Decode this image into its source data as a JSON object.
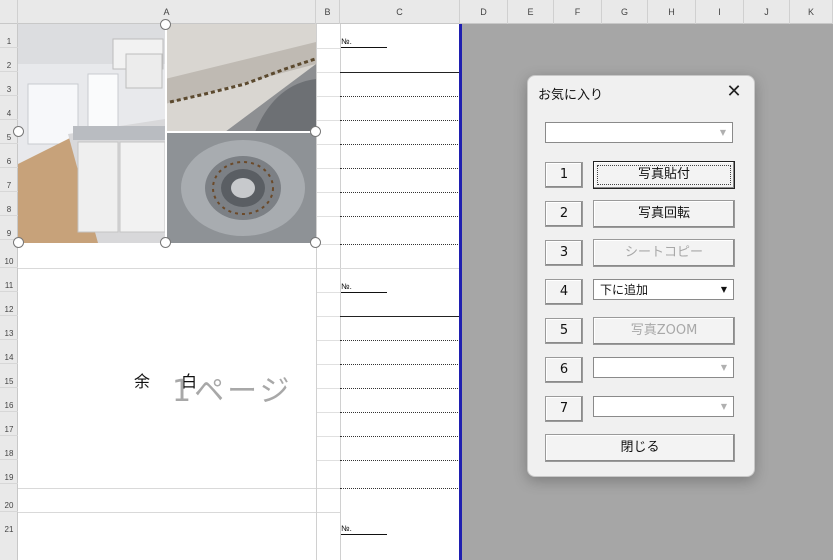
{
  "columns": [
    "A",
    "B",
    "C",
    "D",
    "E",
    "F",
    "G",
    "H",
    "I",
    "J",
    "K"
  ],
  "rows": [
    "1",
    "2",
    "3",
    "4",
    "5",
    "6",
    "7",
    "8",
    "9",
    "10",
    "11",
    "12",
    "13",
    "14",
    "15",
    "16",
    "17",
    "18",
    "19",
    "20",
    "21"
  ],
  "sheet": {
    "no_label": "№.",
    "margin_left": "余",
    "margin_right": "白",
    "page_label": "1ページ"
  },
  "dialog": {
    "title": "お気に入り",
    "close_symbol": "✕",
    "top_combo_value": "",
    "numbers": [
      "1",
      "2",
      "3",
      "4",
      "5",
      "6",
      "7"
    ],
    "actions": {
      "paste_photo": "写真貼付",
      "rotate_photo": "写真回転",
      "copy_sheet": "シートコピー",
      "add_below": "下に追加",
      "photo_zoom": "写真ZOOM",
      "slot6_value": "",
      "slot7_value": ""
    },
    "close_button": "閉じる"
  },
  "icons": {
    "dropdown": "▼",
    "close": "close-icon"
  },
  "colors": {
    "page_border": "#1f1fb0",
    "gray_area": "#a6a6a6",
    "dialog_bg": "#f0f0f0"
  }
}
